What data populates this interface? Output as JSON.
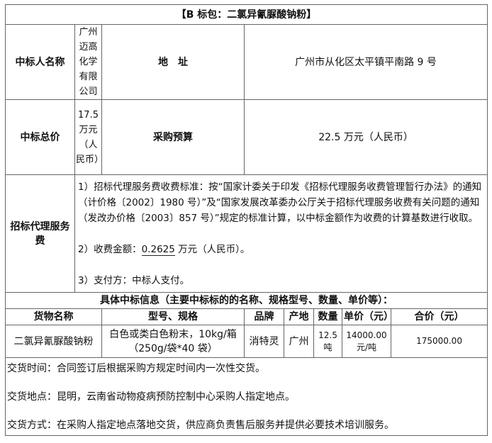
{
  "title": "【B 标包：二氯异氰脲酸钠粉】",
  "winner": {
    "label": "中标人名称",
    "value": "广州迈高化学有限公司",
    "address_label": "地　址",
    "address": "广州市从化区太平镇平南路 9 号"
  },
  "total": {
    "label": "中标总价",
    "value": "17.5 万元（人民币）",
    "budget_label": "采购预算",
    "budget_value": "22.5 万元（人民币）"
  },
  "fee": {
    "label": "招标代理服务费",
    "item1": "1）招标代理服务费收费标准：按“国家计委关于印发《招标代理服务收费管理暂行办法》的通知（计价格〔2002〕1980 号）”及“国家发展改革委办公厅关于招标代理服务收费有关问题的通知（发改办价格〔2003〕857 号）”规定的标准计算，以中标金额作为收费的计算基数进行收取。",
    "item2_prefix": "2）收费金额：",
    "item2_amount": "0.2625",
    "item2_suffix": " 万元（人民币）。",
    "item3": "3）支付方：中标人支付。"
  },
  "detail_header": "具体中标信息（主要中标标的的名称、规格型号、数量、单价等）：",
  "columns": [
    "货物名称",
    "型号、规格",
    "品牌",
    "产地",
    "数量",
    "单价（元）",
    "合价（元）"
  ],
  "row": {
    "name": "二氯异氰脲酸钠粉",
    "spec": "白色或类白色粉末，10kg/箱（250g/袋*40 袋）",
    "brand": "消特灵",
    "origin": "广州",
    "qty": "12.5 吨",
    "unit_price": "14000.00 元/吨",
    "total_price": "175000.00"
  },
  "delivery_time": "交货时间：合同签订后根据采购方规定时间内一次性交货。",
  "delivery_place": "交货地点：昆明，云南省动物疫病预防控制中心采购人指定地点。",
  "delivery_method": "交货方式：在采购人指定地点落地交货，供应商负责售后服务并提供必要技术培训服务。"
}
